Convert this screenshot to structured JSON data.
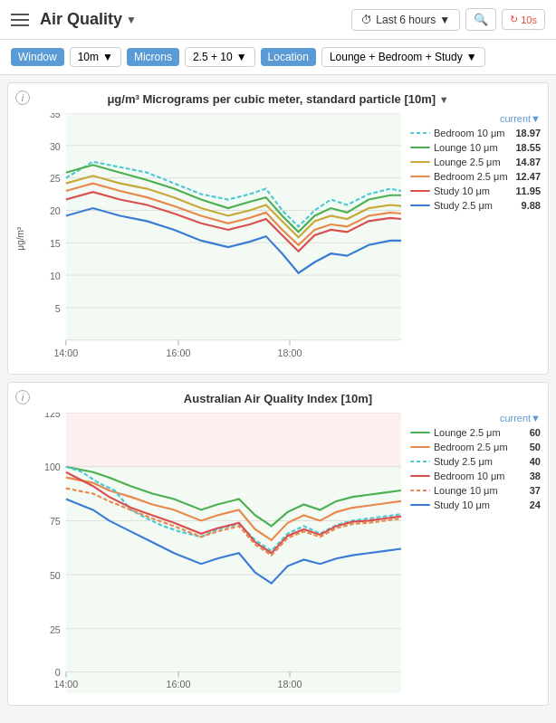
{
  "header": {
    "title": "Air Quality",
    "dropdown_arrow": "▼",
    "time_label": "Last 6 hours",
    "refresh_label": "10s",
    "hamburger_icon": "menu-icon",
    "clock_icon": "⏱",
    "search_symbol": "🔍",
    "refresh_symbol": "↻"
  },
  "filters": {
    "window_label": "Window",
    "window_value": "10m",
    "microns_label": "Microns",
    "microns_value": "2.5 + 10",
    "location_label": "Location",
    "location_value": "Lounge + Bedroom + Study"
  },
  "chart1": {
    "info_icon": "i",
    "title": "μg/m³ Micrograms per cubic meter, standard particle [10m]",
    "title_arrow": "▼",
    "y_label": "μg/m³",
    "legend_header": "current▼",
    "x_ticks": [
      "14:00",
      "16:00",
      "18:00"
    ],
    "y_ticks": [
      "35",
      "30",
      "25",
      "20",
      "15",
      "10",
      "5"
    ],
    "legend_items": [
      {
        "label": "Bedroom 10 μm",
        "color": "#4ec9d4",
        "style": "dashed",
        "value": "18.97"
      },
      {
        "label": "Lounge 10 μm",
        "color": "#4caf50",
        "style": "solid",
        "value": "18.55"
      },
      {
        "label": "Lounge 2.5 μm",
        "color": "#c8a838",
        "style": "solid",
        "value": "14.87"
      },
      {
        "label": "Bedroom 2.5 μm",
        "color": "#e8884c",
        "style": "solid",
        "value": "12.47"
      },
      {
        "label": "Study 10 μm",
        "color": "#d94f4f",
        "style": "solid",
        "value": "11.95"
      },
      {
        "label": "Study 2.5 μm",
        "color": "#3a7bd5",
        "style": "solid",
        "value": "9.88"
      }
    ]
  },
  "chart2": {
    "info_icon": "i",
    "title": "Australian Air Quality Index [10m]",
    "y_label": "",
    "legend_header": "current▼",
    "x_ticks": [
      "14:00",
      "16:00",
      "18:00"
    ],
    "y_ticks": [
      "125",
      "100",
      "75",
      "50",
      "25",
      "0"
    ],
    "legend_items": [
      {
        "label": "Lounge 2.5 μm",
        "color": "#4caf50",
        "style": "solid",
        "value": "60"
      },
      {
        "label": "Bedroom 2.5 μm",
        "color": "#e8884c",
        "style": "solid",
        "value": "50"
      },
      {
        "label": "Study 2.5 μm",
        "color": "#4ec9d4",
        "style": "dashed",
        "value": "40"
      },
      {
        "label": "Bedroom 10 μm",
        "color": "#d94f4f",
        "style": "solid",
        "value": "38"
      },
      {
        "label": "Lounge 10 μm",
        "color": "#e8884c",
        "style": "dashed",
        "value": "37"
      },
      {
        "label": "Study 10 μm",
        "color": "#3a7bd5",
        "style": "solid",
        "value": "24"
      }
    ]
  }
}
